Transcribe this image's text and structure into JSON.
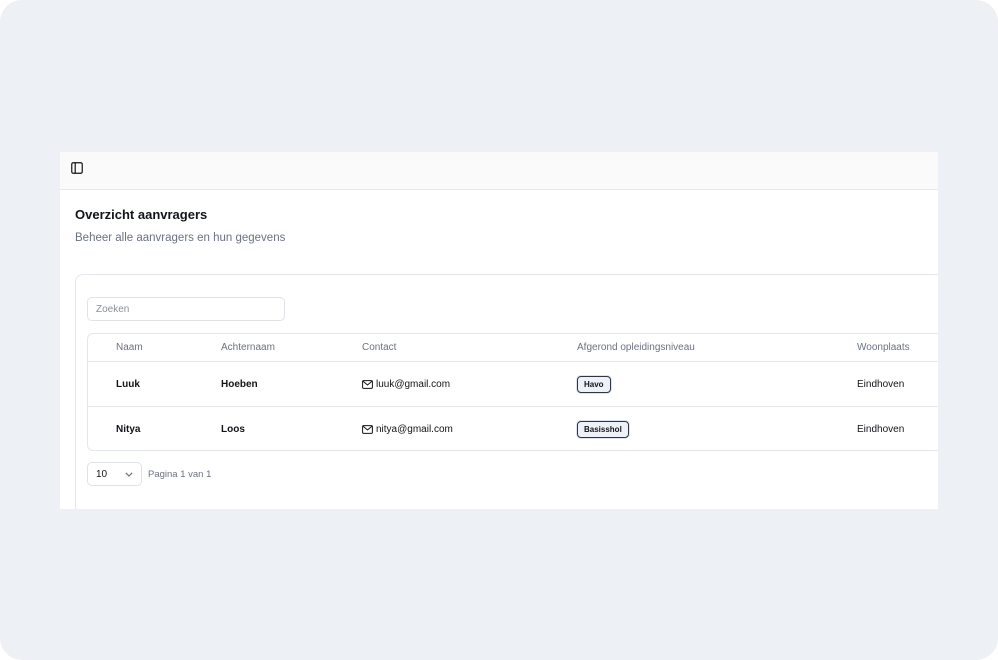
{
  "header": {
    "toggle_icon": "sidebar-toggle-icon"
  },
  "page": {
    "title": "Overzicht aanvragers",
    "subtitle": "Beheer alle aanvragers en hun gegevens"
  },
  "search": {
    "placeholder": "Zoeken",
    "value": ""
  },
  "table": {
    "columns": [
      "Naam",
      "Achternaam",
      "Contact",
      "Afgerond opleidingsniveau",
      "Woonplaats"
    ],
    "rows": [
      {
        "naam": "Luuk",
        "achternaam": "Hoeben",
        "email": "luuk@gmail.com",
        "niveau": "Havo",
        "woonplaats": "Eindhoven"
      },
      {
        "naam": "Nitya",
        "achternaam": "Loos",
        "email": "nitya@gmail.com",
        "niveau": "Basisshol",
        "woonplaats": "Eindhoven"
      }
    ]
  },
  "pagination": {
    "page_size": "10",
    "info": "Pagina 1 van 1"
  },
  "colors": {
    "background": "#edf0f5",
    "badge_bg": "#eef2f8",
    "badge_border": "#2f3542"
  }
}
